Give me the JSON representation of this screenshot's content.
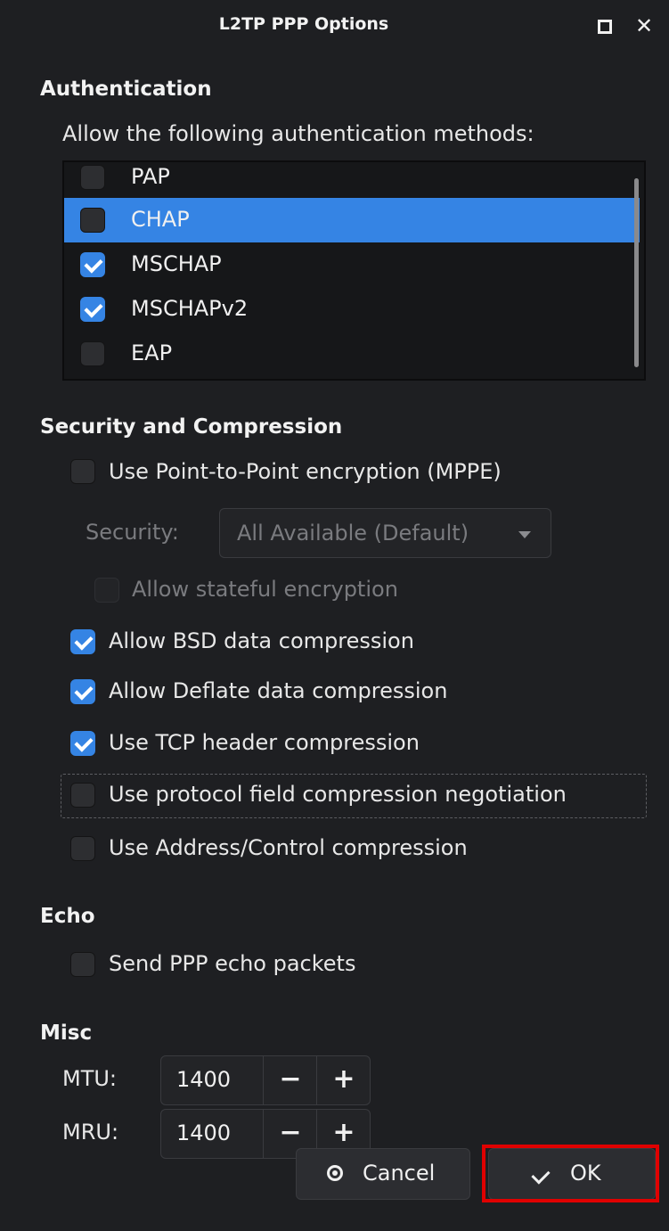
{
  "window": {
    "title": "L2TP PPP Options"
  },
  "authentication": {
    "heading": "Authentication",
    "prompt": "Allow the following authentication methods:",
    "methods": [
      {
        "label": "PAP",
        "checked": false,
        "selected": false
      },
      {
        "label": "CHAP",
        "checked": false,
        "selected": true
      },
      {
        "label": "MSCHAP",
        "checked": true,
        "selected": false
      },
      {
        "label": "MSCHAPv2",
        "checked": true,
        "selected": false
      },
      {
        "label": "EAP",
        "checked": false,
        "selected": false
      }
    ]
  },
  "security": {
    "heading": "Security and Compression",
    "mppe_label": "Use Point-to-Point encryption (MPPE)",
    "mppe_checked": false,
    "security_label": "Security:",
    "security_value": "All Available (Default)",
    "stateful_label": "Allow stateful encryption",
    "stateful_checked": false,
    "bsd_label": "Allow BSD data compression",
    "bsd_checked": true,
    "deflate_label": "Allow Deflate data compression",
    "deflate_checked": true,
    "tcp_label": "Use TCP header compression",
    "tcp_checked": true,
    "protocol_label": "Use protocol field compression negotiation",
    "protocol_checked": false,
    "address_label": "Use Address/Control compression",
    "address_checked": false
  },
  "echo": {
    "heading": "Echo",
    "send_label": "Send PPP echo packets",
    "send_checked": false
  },
  "misc": {
    "heading": "Misc",
    "mtu_label": "MTU:",
    "mtu_value": "1400",
    "mru_label": "MRU:",
    "mru_value": "1400",
    "minus": "−",
    "plus": "+"
  },
  "buttons": {
    "cancel": "Cancel",
    "ok": "OK"
  },
  "colors": {
    "accent": "#3584e4",
    "highlight_outline": "#e00000",
    "background": "#1e1f22"
  }
}
